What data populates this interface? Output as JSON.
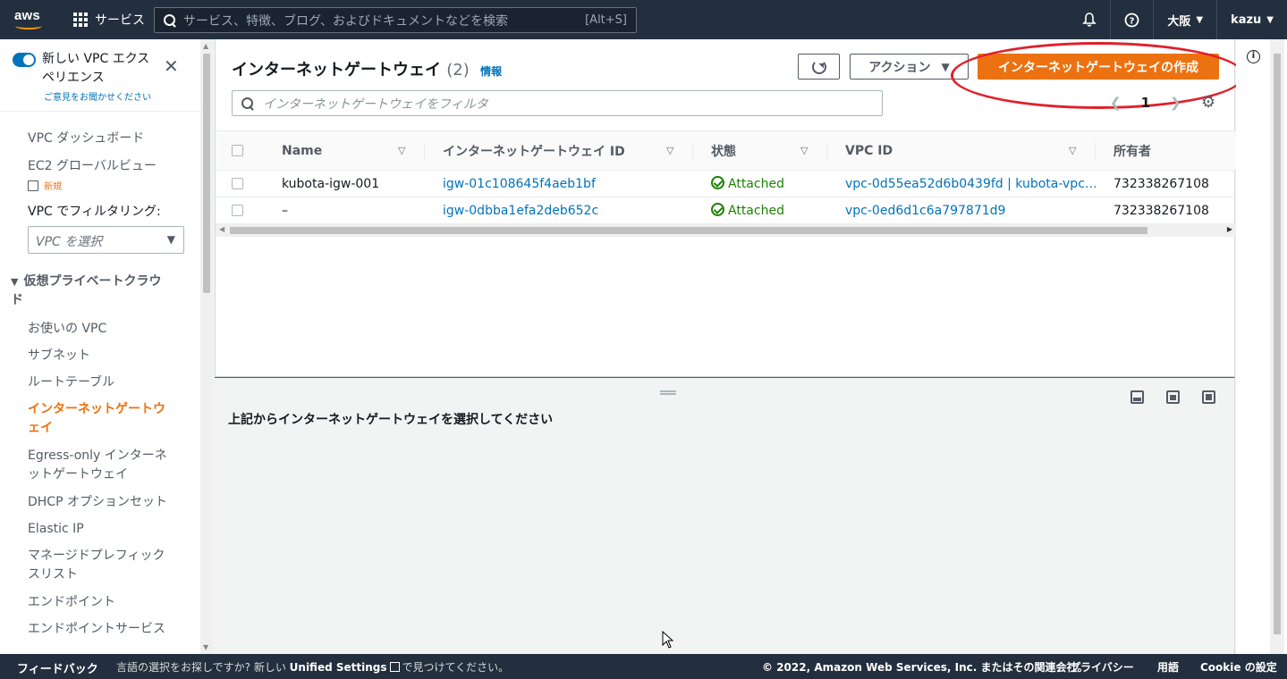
{
  "topbar": {
    "logo": "aws",
    "services_label": "サービス",
    "search_placeholder": "サービス、特徴、ブログ、およびドキュメントなどを検索",
    "search_shortcut": "[Alt+S]",
    "region": "大阪",
    "user": "kazu"
  },
  "sidebar": {
    "new_experience": "新しい VPC エクスペリエンス",
    "feedback_link": "ご意見をお聞かせください",
    "dashboard": "VPC ダッシュボード",
    "global_view": "EC2 グローバルビュー",
    "new_badge": "新規",
    "filter_label": "VPC でフィルタリング:",
    "filter_select": "VPC を選択",
    "section": "仮想プライベートクラウド",
    "items": [
      "お使いの VPC",
      "サブネット",
      "ルートテーブル",
      "インターネットゲートウェイ",
      "Egress-only インターネットゲートウェイ",
      "DHCP オプションセット",
      "Elastic IP",
      "マネージドプレフィックスリスト",
      "エンドポイント",
      "エンドポイントサービス"
    ]
  },
  "main": {
    "title": "インターネットゲートウェイ",
    "count": "(2)",
    "info": "情報",
    "actions": "アクション",
    "create": "インターネットゲートウェイの作成",
    "filter_placeholder": "インターネットゲートウェイをフィルタ",
    "page": "1",
    "columns": [
      "Name",
      "インターネットゲートウェイ ID",
      "状態",
      "VPC ID",
      "所有者"
    ],
    "rows": [
      {
        "name": "kubota-igw-001",
        "id": "igw-01c108645f4aeb1bf",
        "state": "Attached",
        "vpc": "vpc-0d55ea52d6b0439fd | kubota-vpc…",
        "owner": "732338267108"
      },
      {
        "name": "–",
        "id": "igw-0dbba1efa2deb652c",
        "state": "Attached",
        "vpc": "vpc-0ed6d1c6a797871d9",
        "owner": "732338267108"
      }
    ]
  },
  "split": {
    "message": "上記からインターネットゲートウェイを選択してください"
  },
  "footer": {
    "feedback": "フィードバック",
    "msg_pre": "言語の選択をお探しですか? 新しい",
    "msg_bold": "Unified Settings",
    "msg_post": "で見つけてください。",
    "copyright": "© 2022, Amazon Web Services, Inc. またはその関連会社。",
    "privacy": "プライバシー",
    "terms": "用語",
    "cookie": "Cookie の設定"
  },
  "colors": {
    "accent": "#ec7211",
    "link": "#0073bb",
    "header": "#232f3e",
    "success": "#1d8102",
    "highlight": "#e0202a"
  }
}
